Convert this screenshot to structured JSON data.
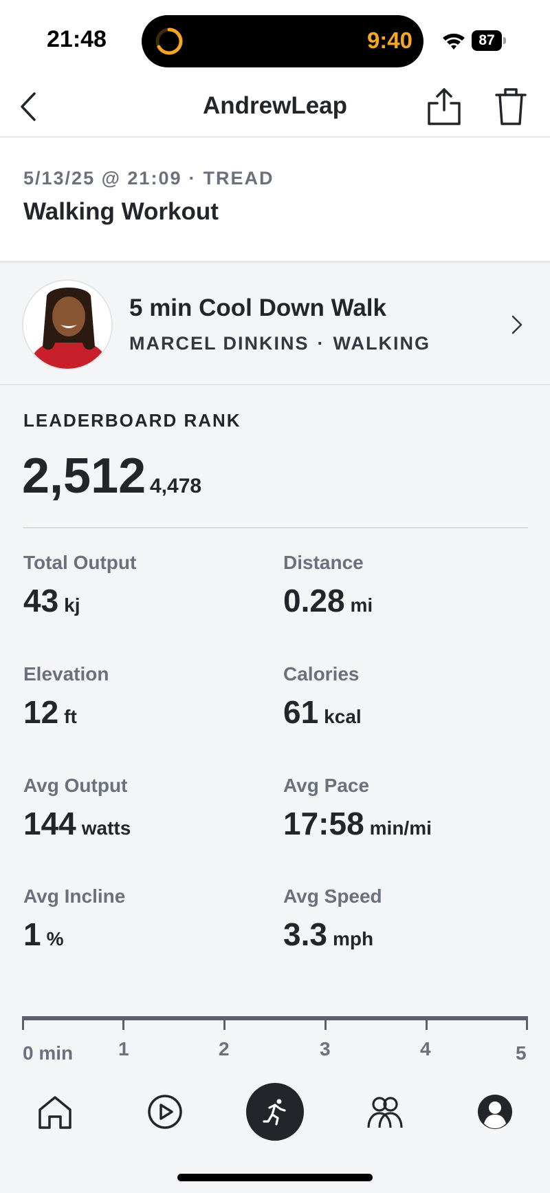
{
  "status": {
    "time": "21:48",
    "timer": "9:40",
    "battery": "87"
  },
  "nav": {
    "title": "AndrewLeap"
  },
  "workout": {
    "date": "5/13/25 @ 21:09",
    "separator": "·",
    "category": "TREAD",
    "title": "Walking Workout"
  },
  "class_info": {
    "title": "5 min Cool Down Walk",
    "instructor": "MARCEL DINKINS",
    "separator": "·",
    "discipline": "WALKING"
  },
  "leaderboard": {
    "label": "LEADERBOARD RANK",
    "rank": "2,512",
    "total": "4,478"
  },
  "metrics": [
    {
      "label": "Total Output",
      "value": "43",
      "unit": "kj"
    },
    {
      "label": "Distance",
      "value": "0.28",
      "unit": "mi"
    },
    {
      "label": "Elevation",
      "value": "12",
      "unit": "ft"
    },
    {
      "label": "Calories",
      "value": "61",
      "unit": "kcal"
    },
    {
      "label": "Avg Output",
      "value": "144",
      "unit": "watts"
    },
    {
      "label": "Avg Pace",
      "value": "17:58",
      "unit": "min/mi"
    },
    {
      "label": "Avg Incline",
      "value": "1",
      "unit": "%"
    },
    {
      "label": "Avg Speed",
      "value": "3.3",
      "unit": "mph"
    }
  ],
  "timeline": {
    "ticks": [
      "0 min",
      "1",
      "2",
      "3",
      "4",
      "5"
    ]
  },
  "tabs": [
    {
      "name": "home",
      "icon": "home-icon"
    },
    {
      "name": "classes",
      "icon": "play-circle-icon"
    },
    {
      "name": "workouts",
      "icon": "running-person-icon",
      "active": true
    },
    {
      "name": "community",
      "icon": "people-icon"
    },
    {
      "name": "profile",
      "icon": "profile-icon"
    }
  ],
  "colors": {
    "accent_timer": "#f5a623",
    "text_primary": "#222529",
    "text_secondary": "#6b717c",
    "background": "#f4f5f7"
  }
}
